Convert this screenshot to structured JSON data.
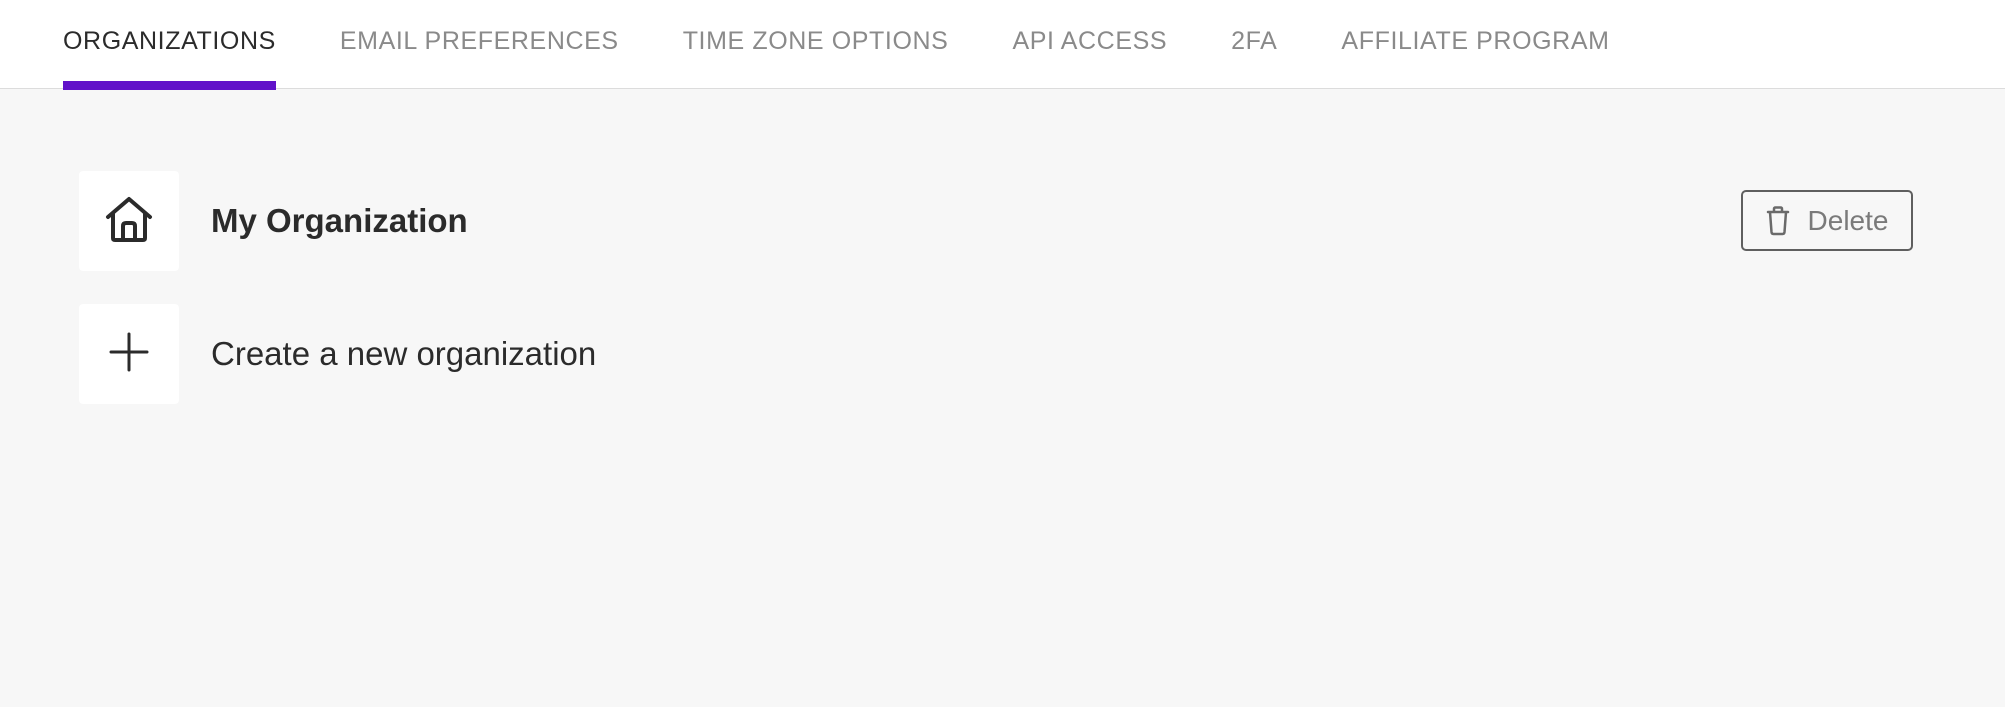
{
  "tabs": [
    {
      "label": "ORGANIZATIONS",
      "active": true
    },
    {
      "label": "EMAIL PREFERENCES",
      "active": false
    },
    {
      "label": "TIME ZONE OPTIONS",
      "active": false
    },
    {
      "label": "API ACCESS",
      "active": false
    },
    {
      "label": "2FA",
      "active": false
    },
    {
      "label": "AFFILIATE PROGRAM",
      "active": false
    }
  ],
  "organizations": [
    {
      "name": "My Organization",
      "icon": "home-icon"
    }
  ],
  "create": {
    "label": "Create a new organization",
    "icon": "plus-icon"
  },
  "actions": {
    "delete_label": "Delete",
    "delete_icon": "trash-icon"
  },
  "colors": {
    "accent": "#6112c9",
    "background": "#f7f7f7",
    "text": "#2b2b2b",
    "muted": "#8a8a8a"
  }
}
